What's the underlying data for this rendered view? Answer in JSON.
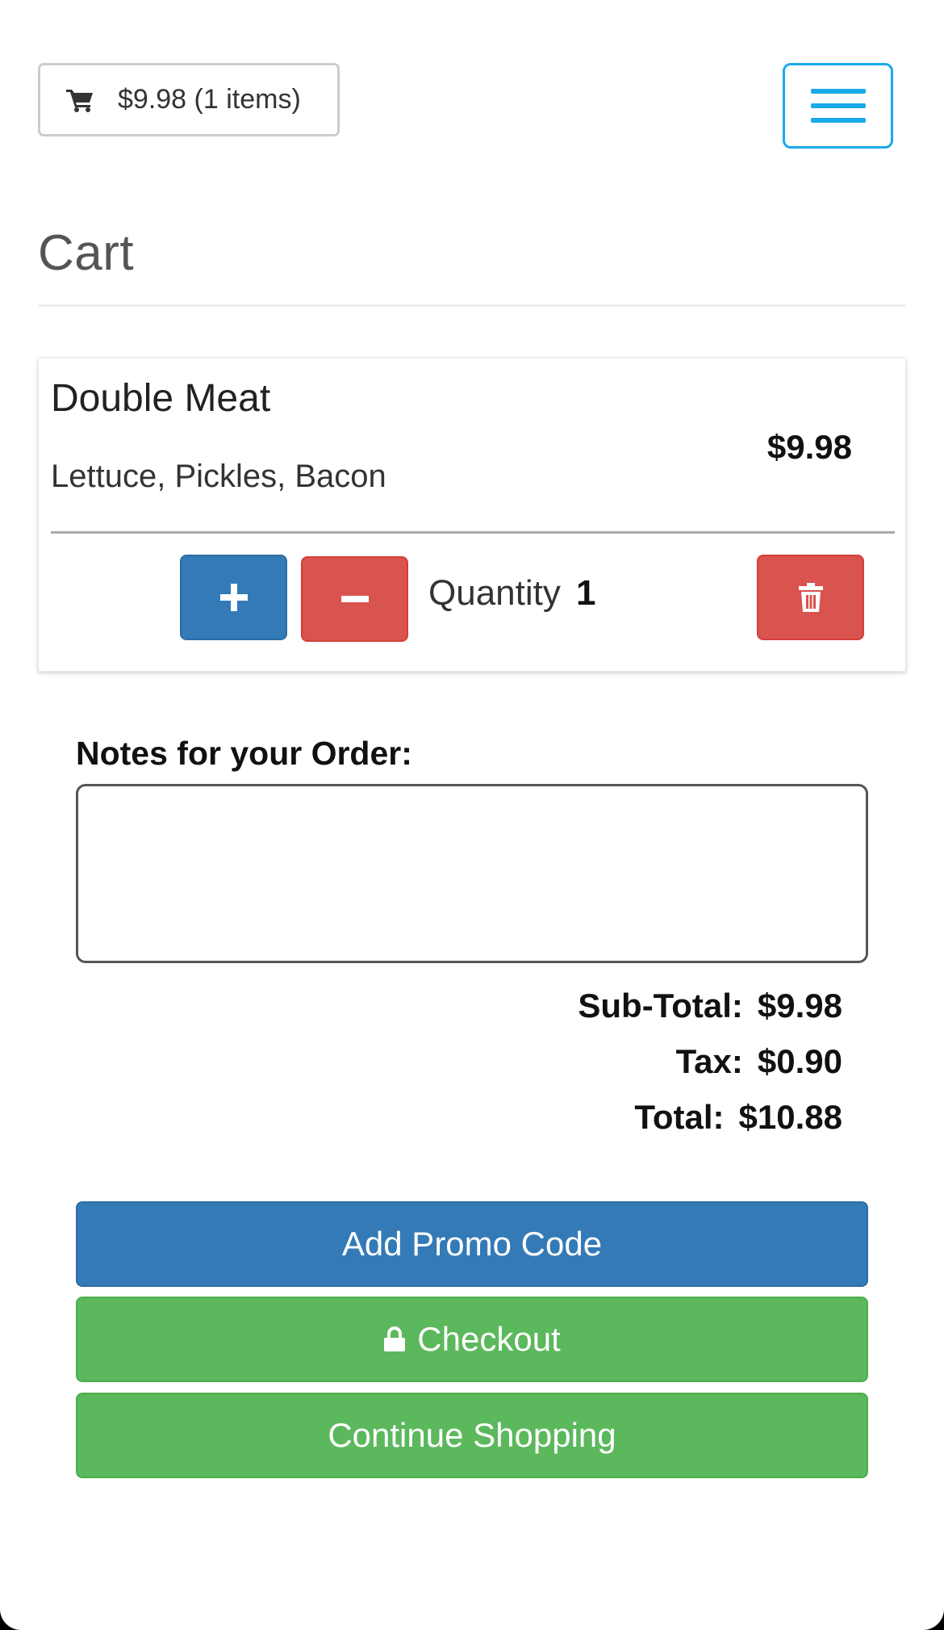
{
  "header": {
    "cart_summary": "$9.98 (1 items)",
    "cart_icon": "shopping-cart-icon",
    "menu_icon": "hamburger-menu-icon"
  },
  "page": {
    "title": "Cart"
  },
  "cart": {
    "items": [
      {
        "name": "Double Meat",
        "options": "Lettuce, Pickles, Bacon",
        "price": "$9.98",
        "quantity_label": "Quantity",
        "quantity": "1"
      }
    ]
  },
  "notes": {
    "label": "Notes for your Order:",
    "value": "",
    "placeholder": ""
  },
  "totals": {
    "subtotal_label": "Sub-Total:",
    "subtotal": "$9.98",
    "tax_label": "Tax:",
    "tax": "$0.90",
    "total_label": "Total:",
    "total": "$10.88"
  },
  "actions": {
    "promo_label": "Add Promo Code",
    "checkout_label": "Checkout",
    "continue_label": "Continue Shopping"
  },
  "colors": {
    "primary_blue": "#337ab7",
    "danger_red": "#d9534f",
    "success_green": "#5cb85c",
    "menu_accent": "#1aa9e9"
  }
}
